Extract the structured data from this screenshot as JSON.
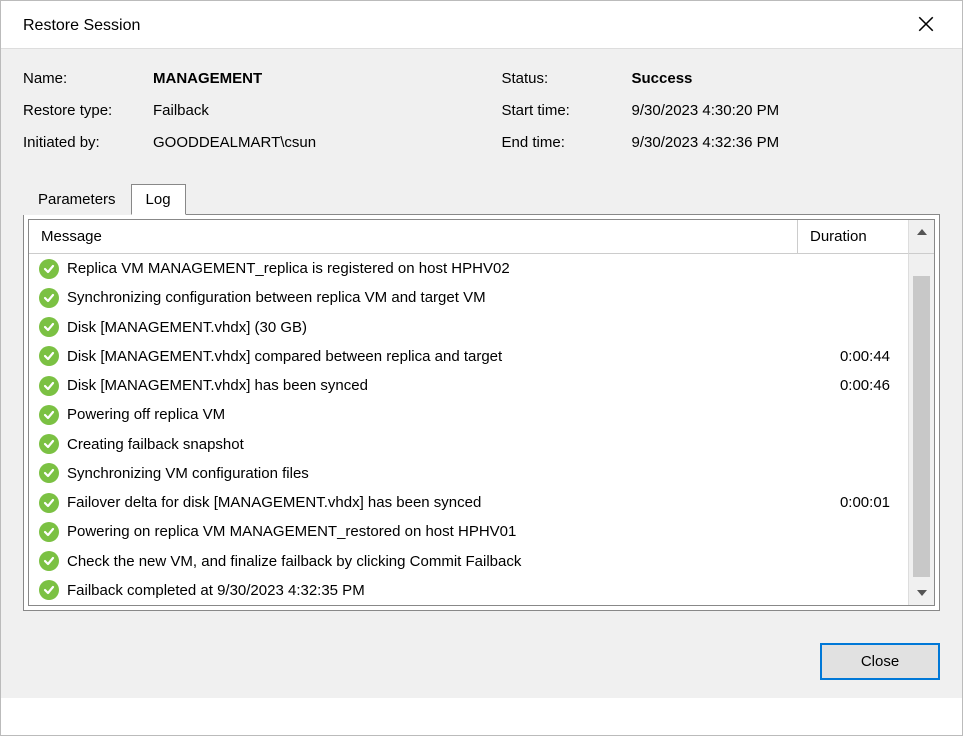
{
  "window": {
    "title": "Restore Session"
  },
  "info": {
    "left": {
      "name_label": "Name:",
      "name_value": "MANAGEMENT",
      "type_label": "Restore type:",
      "type_value": "Failback",
      "init_label": "Initiated by:",
      "init_value": "GOODDEALMART\\csun"
    },
    "right": {
      "status_label": "Status:",
      "status_value": "Success",
      "start_label": "Start time:",
      "start_value": "9/30/2023 4:30:20 PM",
      "end_label": "End time:",
      "end_value": "9/30/2023 4:32:36 PM"
    }
  },
  "tabs": {
    "parameters": "Parameters",
    "log": "Log"
  },
  "columns": {
    "message": "Message",
    "duration": "Duration"
  },
  "log": [
    {
      "msg": "Replica VM MANAGEMENT_replica is registered on host HPHV02",
      "dur": ""
    },
    {
      "msg": "Synchronizing configuration between replica VM and target VM",
      "dur": ""
    },
    {
      "msg": "Disk [MANAGEMENT.vhdx] (30 GB)",
      "dur": ""
    },
    {
      "msg": "Disk [MANAGEMENT.vhdx] compared between replica and target",
      "dur": "0:00:44"
    },
    {
      "msg": "Disk [MANAGEMENT.vhdx] has been synced",
      "dur": "0:00:46"
    },
    {
      "msg": "Powering off replica VM",
      "dur": ""
    },
    {
      "msg": "Creating failback snapshot",
      "dur": ""
    },
    {
      "msg": "Synchronizing VM configuration files",
      "dur": ""
    },
    {
      "msg": "Failover delta for disk [MANAGEMENT.vhdx] has been synced",
      "dur": "0:00:01"
    },
    {
      "msg": "Powering on replica VM MANAGEMENT_restored on host HPHV01",
      "dur": ""
    },
    {
      "msg": "Check the new VM, and finalize failback by clicking Commit Failback",
      "dur": ""
    },
    {
      "msg": "Failback completed at 9/30/2023 4:32:35 PM",
      "dur": ""
    }
  ],
  "buttons": {
    "close": "Close"
  }
}
